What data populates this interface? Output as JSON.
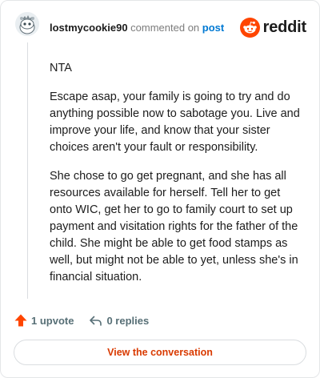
{
  "header": {
    "username": "lostmycookie90",
    "action_text": "commented on",
    "post_link": "post",
    "brand_word": "reddit"
  },
  "comment": {
    "paragraphs": [
      "NTA",
      "Escape asap, your family is going to try and do anything possible now to sabotage you. Live and improve your life, and know that your sister choices aren't your fault or responsibility.",
      "She chose to go get pregnant, and she has all resources available for herself. Tell her to get onto WIC, get her to go to family court to set up payment and visitation rights for the father of the child. She might be able to get food stamps as well, but might not be able to yet, unless she's in financial situation."
    ]
  },
  "footer": {
    "upvotes": "1 upvote",
    "replies": "0 replies",
    "cta": "View the conversation"
  },
  "colors": {
    "upvote_accent": "#ff4500",
    "link": "#0079d3",
    "cta_text": "#d93a00"
  },
  "icons": {
    "avatar": "snoo-avatar-icon",
    "brand": "reddit-logo-icon",
    "upvote": "upvote-arrow-icon",
    "reply": "reply-arrow-icon"
  }
}
